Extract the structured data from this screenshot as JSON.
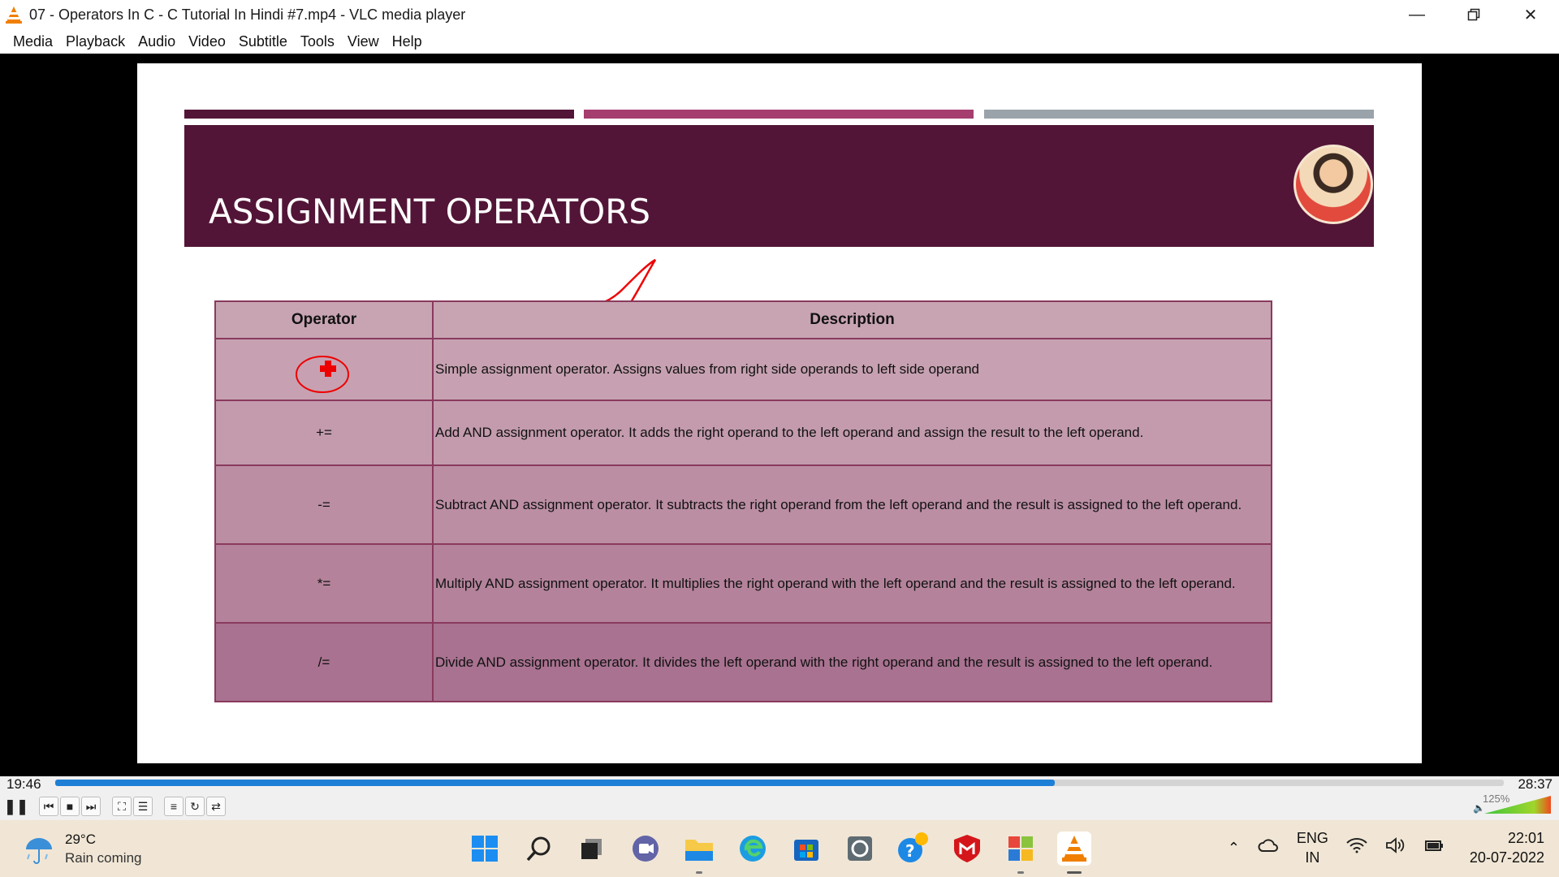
{
  "window": {
    "title": "07 - Operators In C - C Tutorial In Hindi #7.mp4 - VLC media player",
    "controls": [
      "minimize-icon",
      "restore-icon",
      "close-icon"
    ]
  },
  "menu": [
    "Media",
    "Playback",
    "Audio",
    "Video",
    "Subtitle",
    "Tools",
    "View",
    "Help"
  ],
  "slide": {
    "title": "ASSIGNMENT OPERATORS",
    "strip_colors": [
      "#521537",
      "#a53d6f",
      "#9aa3aa"
    ],
    "table": {
      "headers": [
        "Operator",
        "Description"
      ],
      "rows": [
        {
          "op": "=",
          "desc": "Simple assignment operator. Assigns values from right side operands to left side operand"
        },
        {
          "op": "+=",
          "desc": "Add AND assignment operator. It adds the right operand to the left operand and assign the result to the left operand."
        },
        {
          "op": "-=",
          "desc": "Subtract AND assignment operator. It subtracts the right operand from the left operand and the result is assigned to the left operand."
        },
        {
          "op": "*=",
          "desc": "Multiply AND assignment operator. It multiplies the right operand with the left operand and the result is assigned to the left operand."
        },
        {
          "op": "/=",
          "desc": "Divide AND assignment operator. It divides the left operand with the right operand and the result is assigned to the left operand."
        }
      ]
    }
  },
  "player": {
    "elapsed": "19:46",
    "total": "28:37",
    "progress": 0.69,
    "volume_label": "125%",
    "volume_level": 1.0,
    "buttons": [
      "pause-icon",
      "previous-icon",
      "stop-icon",
      "next-icon",
      "fullscreen-icon",
      "extended-settings-icon",
      "playlist-icon",
      "loop-icon",
      "shuffle-icon"
    ]
  },
  "taskbar": {
    "weather_temp": "29°C",
    "weather_desc": "Rain coming",
    "lang_top": "ENG",
    "lang_bottom": "IN",
    "time": "22:01",
    "date": "20-07-2022",
    "apps": [
      "windows-start-icon",
      "search-icon",
      "task-view-icon",
      "chat-icon",
      "file-explorer-icon",
      "edge-icon",
      "store-icon",
      "app-icon",
      "help-icon",
      "mcafee-icon",
      "office-icon",
      "vlc-icon"
    ]
  },
  "colors": {
    "banner": "#521537",
    "seek_fill": "#1e7fd6",
    "taskbar_bg": "#f1e6d5"
  }
}
